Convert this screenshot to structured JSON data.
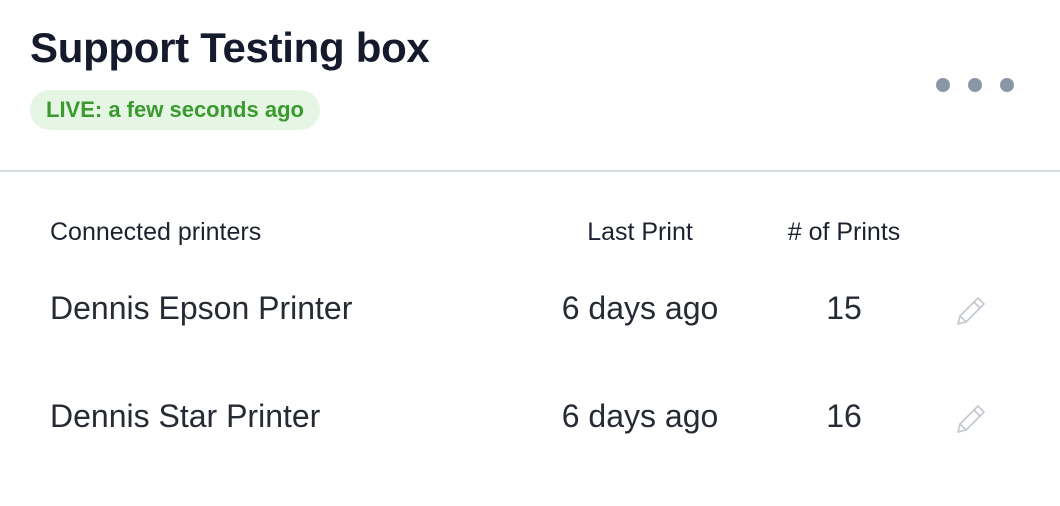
{
  "header": {
    "title": "Support Testing box",
    "status": "LIVE: a few seconds ago",
    "more_icon": "more-horizontal-icon"
  },
  "table": {
    "columns": [
      "Connected printers",
      "Last Print",
      "# of Prints"
    ],
    "rows": [
      {
        "name": "Dennis Epson Printer",
        "last_print": "6 days ago",
        "prints": "15",
        "action_icon": "pencil-icon"
      },
      {
        "name": "Dennis Star Printer",
        "last_print": "6 days ago",
        "prints": "16",
        "action_icon": "pencil-icon"
      }
    ]
  },
  "colors": {
    "title": "#151a2c",
    "live_text": "#3b9a2e",
    "live_background": "#e6f6e4",
    "divider": "#d7dee4",
    "icon_gray": "#8a96a8"
  }
}
